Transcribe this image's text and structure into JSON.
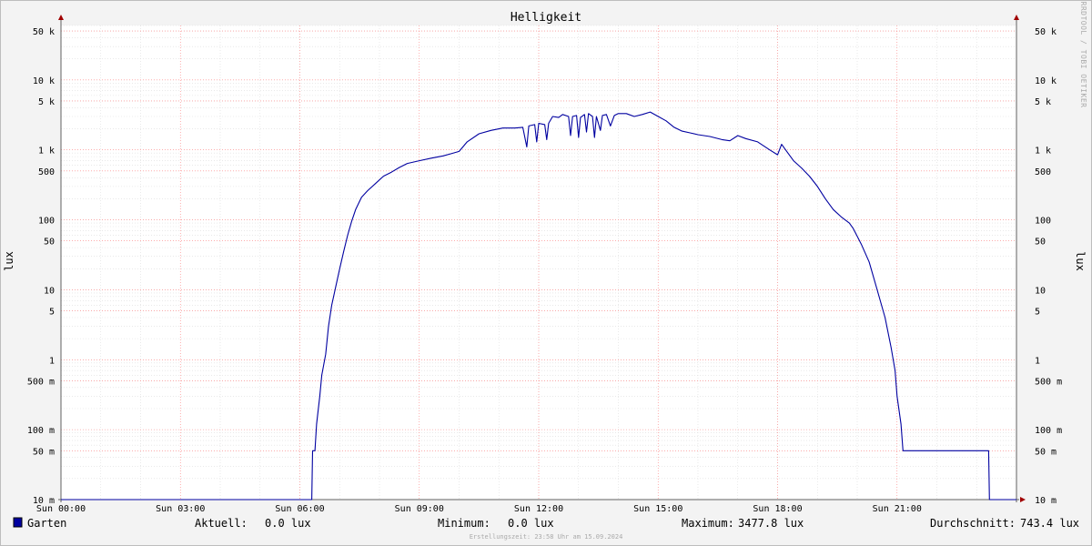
{
  "chart_data": {
    "type": "line",
    "title": "Helligkeit",
    "ylabel": "lux",
    "ylabel_right": "lux",
    "y_scale": "log",
    "ylim": [
      0.01,
      60000
    ],
    "xlim_hours": [
      0,
      24
    ],
    "x_ticks": [
      {
        "hour": 0,
        "label": "Sun 00:00"
      },
      {
        "hour": 3,
        "label": "Sun 03:00"
      },
      {
        "hour": 6,
        "label": "Sun 06:00"
      },
      {
        "hour": 9,
        "label": "Sun 09:00"
      },
      {
        "hour": 12,
        "label": "Sun 12:00"
      },
      {
        "hour": 15,
        "label": "Sun 15:00"
      },
      {
        "hour": 18,
        "label": "Sun 18:00"
      },
      {
        "hour": 21,
        "label": "Sun 21:00"
      }
    ],
    "y_ticks": [
      {
        "value": 50000,
        "label": "50 k"
      },
      {
        "value": 10000,
        "label": "10 k"
      },
      {
        "value": 5000,
        "label": "5 k"
      },
      {
        "value": 1000,
        "label": "1 k"
      },
      {
        "value": 500,
        "label": "500"
      },
      {
        "value": 100,
        "label": "100"
      },
      {
        "value": 50,
        "label": "50"
      },
      {
        "value": 10,
        "label": "10"
      },
      {
        "value": 5,
        "label": "5"
      },
      {
        "value": 1,
        "label": "1"
      },
      {
        "value": 0.5,
        "label": "500 m"
      },
      {
        "value": 0.1,
        "label": "100 m"
      },
      {
        "value": 0.05,
        "label": "50 m"
      },
      {
        "value": 0.01,
        "label": "10 m"
      }
    ],
    "grid": true,
    "series": [
      {
        "name": "Garten",
        "color": "#0000a0",
        "points": [
          [
            0.0,
            0.01
          ],
          [
            6.3,
            0.01
          ],
          [
            6.32,
            0.05
          ],
          [
            6.38,
            0.05
          ],
          [
            6.42,
            0.12
          ],
          [
            6.5,
            0.3
          ],
          [
            6.55,
            0.6
          ],
          [
            6.65,
            1.2
          ],
          [
            6.72,
            3
          ],
          [
            6.8,
            6
          ],
          [
            6.9,
            11
          ],
          [
            7.0,
            20
          ],
          [
            7.1,
            35
          ],
          [
            7.2,
            60
          ],
          [
            7.3,
            95
          ],
          [
            7.4,
            140
          ],
          [
            7.55,
            210
          ],
          [
            7.7,
            260
          ],
          [
            7.9,
            330
          ],
          [
            8.1,
            420
          ],
          [
            8.3,
            480
          ],
          [
            8.5,
            560
          ],
          [
            8.7,
            640
          ],
          [
            9.0,
            700
          ],
          [
            9.3,
            760
          ],
          [
            9.6,
            820
          ],
          [
            9.8,
            880
          ],
          [
            10.0,
            950
          ],
          [
            10.2,
            1300
          ],
          [
            10.5,
            1700
          ],
          [
            10.8,
            1900
          ],
          [
            11.1,
            2050
          ],
          [
            11.4,
            2050
          ],
          [
            11.6,
            2100
          ],
          [
            11.7,
            1100
          ],
          [
            11.75,
            2200
          ],
          [
            11.9,
            2300
          ],
          [
            11.95,
            1300
          ],
          [
            12.0,
            2400
          ],
          [
            12.15,
            2300
          ],
          [
            12.2,
            1400
          ],
          [
            12.25,
            2400
          ],
          [
            12.35,
            3000
          ],
          [
            12.5,
            2900
          ],
          [
            12.6,
            3200
          ],
          [
            12.75,
            3000
          ],
          [
            12.8,
            1600
          ],
          [
            12.85,
            3000
          ],
          [
            12.95,
            3100
          ],
          [
            13.0,
            1500
          ],
          [
            13.05,
            2900
          ],
          [
            13.15,
            3200
          ],
          [
            13.2,
            1800
          ],
          [
            13.25,
            3300
          ],
          [
            13.35,
            3000
          ],
          [
            13.4,
            1500
          ],
          [
            13.45,
            3000
          ],
          [
            13.55,
            1900
          ],
          [
            13.6,
            3100
          ],
          [
            13.7,
            3200
          ],
          [
            13.8,
            2200
          ],
          [
            13.9,
            3100
          ],
          [
            14.0,
            3300
          ],
          [
            14.2,
            3300
          ],
          [
            14.4,
            3000
          ],
          [
            14.6,
            3200
          ],
          [
            14.8,
            3478
          ],
          [
            15.0,
            3000
          ],
          [
            15.2,
            2600
          ],
          [
            15.4,
            2100
          ],
          [
            15.6,
            1850
          ],
          [
            15.8,
            1750
          ],
          [
            16.0,
            1650
          ],
          [
            16.3,
            1550
          ],
          [
            16.6,
            1400
          ],
          [
            16.8,
            1350
          ],
          [
            17.0,
            1600
          ],
          [
            17.2,
            1450
          ],
          [
            17.5,
            1300
          ],
          [
            17.8,
            1000
          ],
          [
            18.0,
            850
          ],
          [
            18.1,
            1200
          ],
          [
            18.2,
            1000
          ],
          [
            18.4,
            700
          ],
          [
            18.6,
            550
          ],
          [
            18.8,
            420
          ],
          [
            19.0,
            300
          ],
          [
            19.2,
            200
          ],
          [
            19.4,
            140
          ],
          [
            19.6,
            110
          ],
          [
            19.8,
            90
          ],
          [
            19.9,
            75
          ],
          [
            20.1,
            45
          ],
          [
            20.3,
            25
          ],
          [
            20.5,
            10
          ],
          [
            20.7,
            4
          ],
          [
            20.85,
            1.5
          ],
          [
            20.95,
            0.7
          ],
          [
            21.0,
            0.3
          ],
          [
            21.1,
            0.12
          ],
          [
            21.15,
            0.05
          ],
          [
            23.3,
            0.05
          ],
          [
            23.32,
            0.01
          ],
          [
            24.0,
            0.01
          ]
        ]
      }
    ]
  },
  "legend": {
    "series_name": "Garten",
    "current_label": "Aktuell:",
    "current_value": "0.0 lux",
    "min_label": "Minimum:",
    "min_value": "0.0 lux",
    "max_label": "Maximum:",
    "max_value": "3477.8 lux",
    "avg_label": "Durchschnitt:",
    "avg_value": "743.4 lux"
  },
  "watermark": "RRDTOOL / TOBI OETIKER",
  "footer": "Erstellungszeit: 23:58 Uhr am 15.09.2024",
  "colors": {
    "background": "#f3f3f3",
    "plot_background": "#ffffff",
    "major_grid": "#ff8080",
    "minor_grid": "#dcdcdc",
    "axis": "#606060",
    "arrow": "#a00000",
    "series": "#0000a0"
  }
}
